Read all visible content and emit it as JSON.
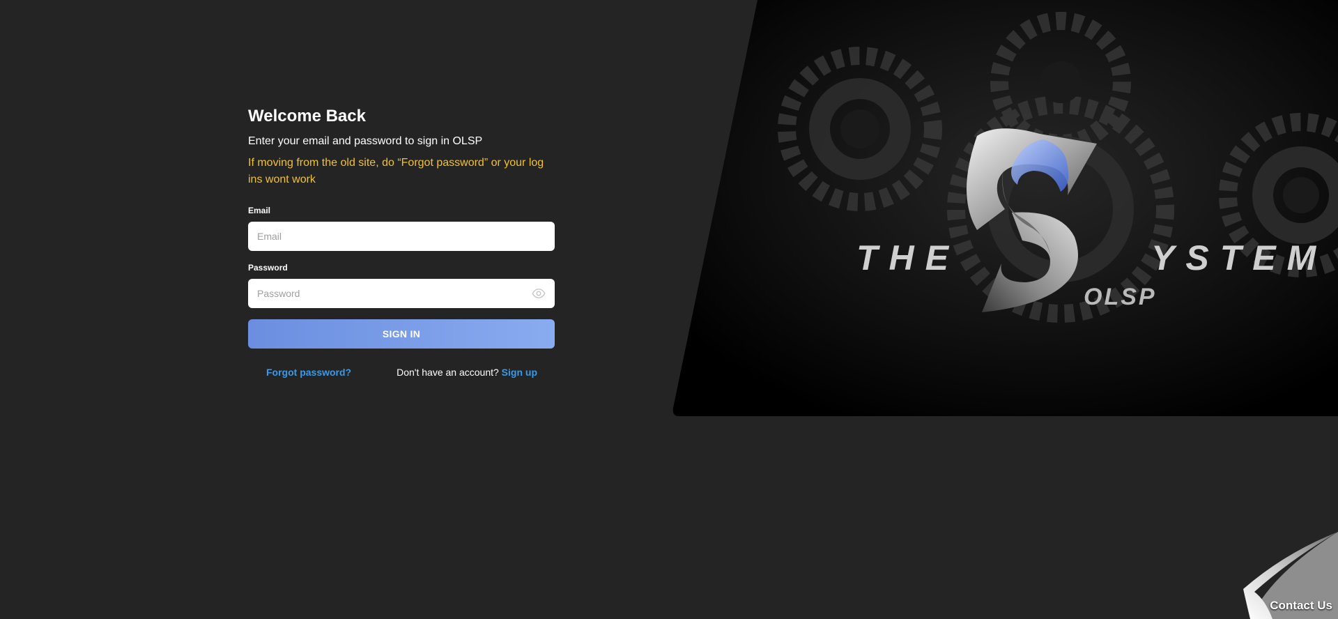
{
  "login": {
    "title": "Welcome Back",
    "subtitle": "Enter your email and password to sign in OLSP",
    "warning": "If moving from the old site, do “Forgot password” or your log ins wont work",
    "email_label": "Email",
    "email_placeholder": "Email",
    "email_value": "",
    "password_label": "Password",
    "password_placeholder": "Password",
    "password_value": "",
    "signin_label": "SIGN IN",
    "forgot_label": "Forgot password?",
    "no_account_text": "Don't have an account?",
    "signup_label": "Sign up"
  },
  "hero": {
    "logo_left": "THE",
    "logo_right": "YSTEM",
    "logo_sub": "OLSP"
  },
  "contact": {
    "label": "Contact Us"
  },
  "colors": {
    "background": "#242424",
    "warning": "#f1c232",
    "link": "#3b9ae8",
    "button": "#7a9de8"
  },
  "icons": {
    "password_toggle": "eye-icon",
    "gear": "gear-icon",
    "page_curl": "page-curl-icon"
  }
}
